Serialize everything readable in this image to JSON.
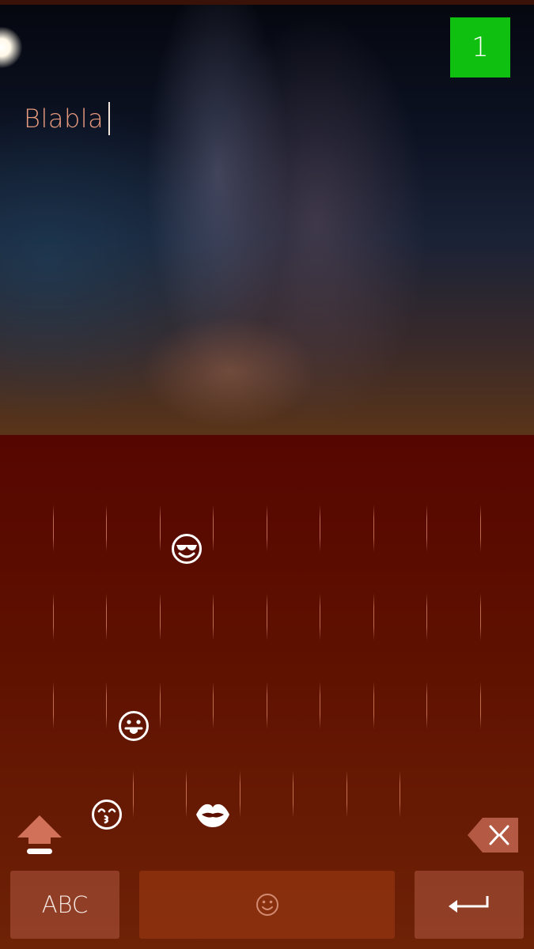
{
  "status": {
    "counter_badge": "1",
    "badge_color": "#10c010"
  },
  "editor": {
    "text": "Blabla"
  },
  "keyboard": {
    "layout": "emoji",
    "background_color": "#5a0c00",
    "accent_color": "#e79a7e",
    "emoji_keys": [
      {
        "name": "smiling-face-with-sunglasses",
        "row": 1
      },
      {
        "name": "face-with-tongue",
        "row": 3
      },
      {
        "name": "kissing-face-with-smiling-eyes",
        "row": 4
      },
      {
        "name": "kiss-mark",
        "row": 4
      }
    ],
    "shift_icon": "shift-arrow-icon",
    "backspace_icon": "backspace-icon",
    "abc_label": "ABC",
    "space_icon": "smiley-icon",
    "enter_icon": "enter-arrow-icon"
  }
}
